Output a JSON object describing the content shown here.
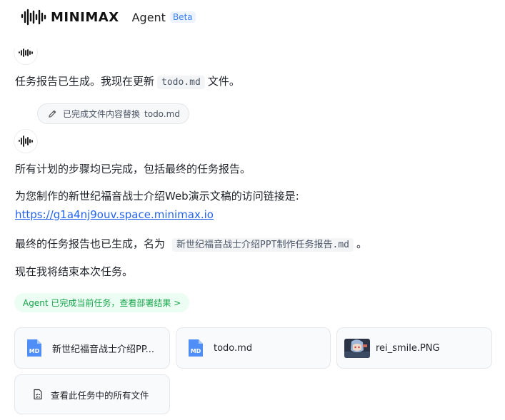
{
  "header": {
    "brand": "MINIMAX",
    "product": "Agent",
    "badge": "Beta"
  },
  "messages": {
    "line1_prefix": "任务报告已生成。我现在更新",
    "line1_code": "todo.md",
    "line1_suffix": "文件。",
    "tool_call": {
      "label": "已完成文件内容替换",
      "file": "todo.md",
      "icon": "pencil-icon"
    },
    "para1": "所有计划的步骤均已完成，包括最终的任务报告。",
    "para2": "为您制作的新世纪福音战士介绍Web演示文稿的访问链接是:",
    "link": "https://g1a4nj9ouv.space.minimax.io",
    "para3_prefix": "最终的任务报告也已生成，名为",
    "para3_code": "新世纪福音战士介绍PPT制作任务报告.md",
    "para3_suffix": "。",
    "para4": "现在我将结束本次任务。"
  },
  "status_pill": "Agent 已完成当前任务，查看部署结果 >",
  "files": [
    {
      "name": "新世纪福音战士介绍PP...",
      "icon": "md-file-icon"
    },
    {
      "name": "todo.md",
      "icon": "md-file-icon"
    },
    {
      "name": "rei_smile.PNG",
      "icon": "image-thumbnail"
    }
  ],
  "view_all": "查看此任务中的所有文件",
  "colors": {
    "accent_blue": "#2563eb",
    "success_green": "#16a34a",
    "md_icon_blue": "#4f8ef7"
  }
}
